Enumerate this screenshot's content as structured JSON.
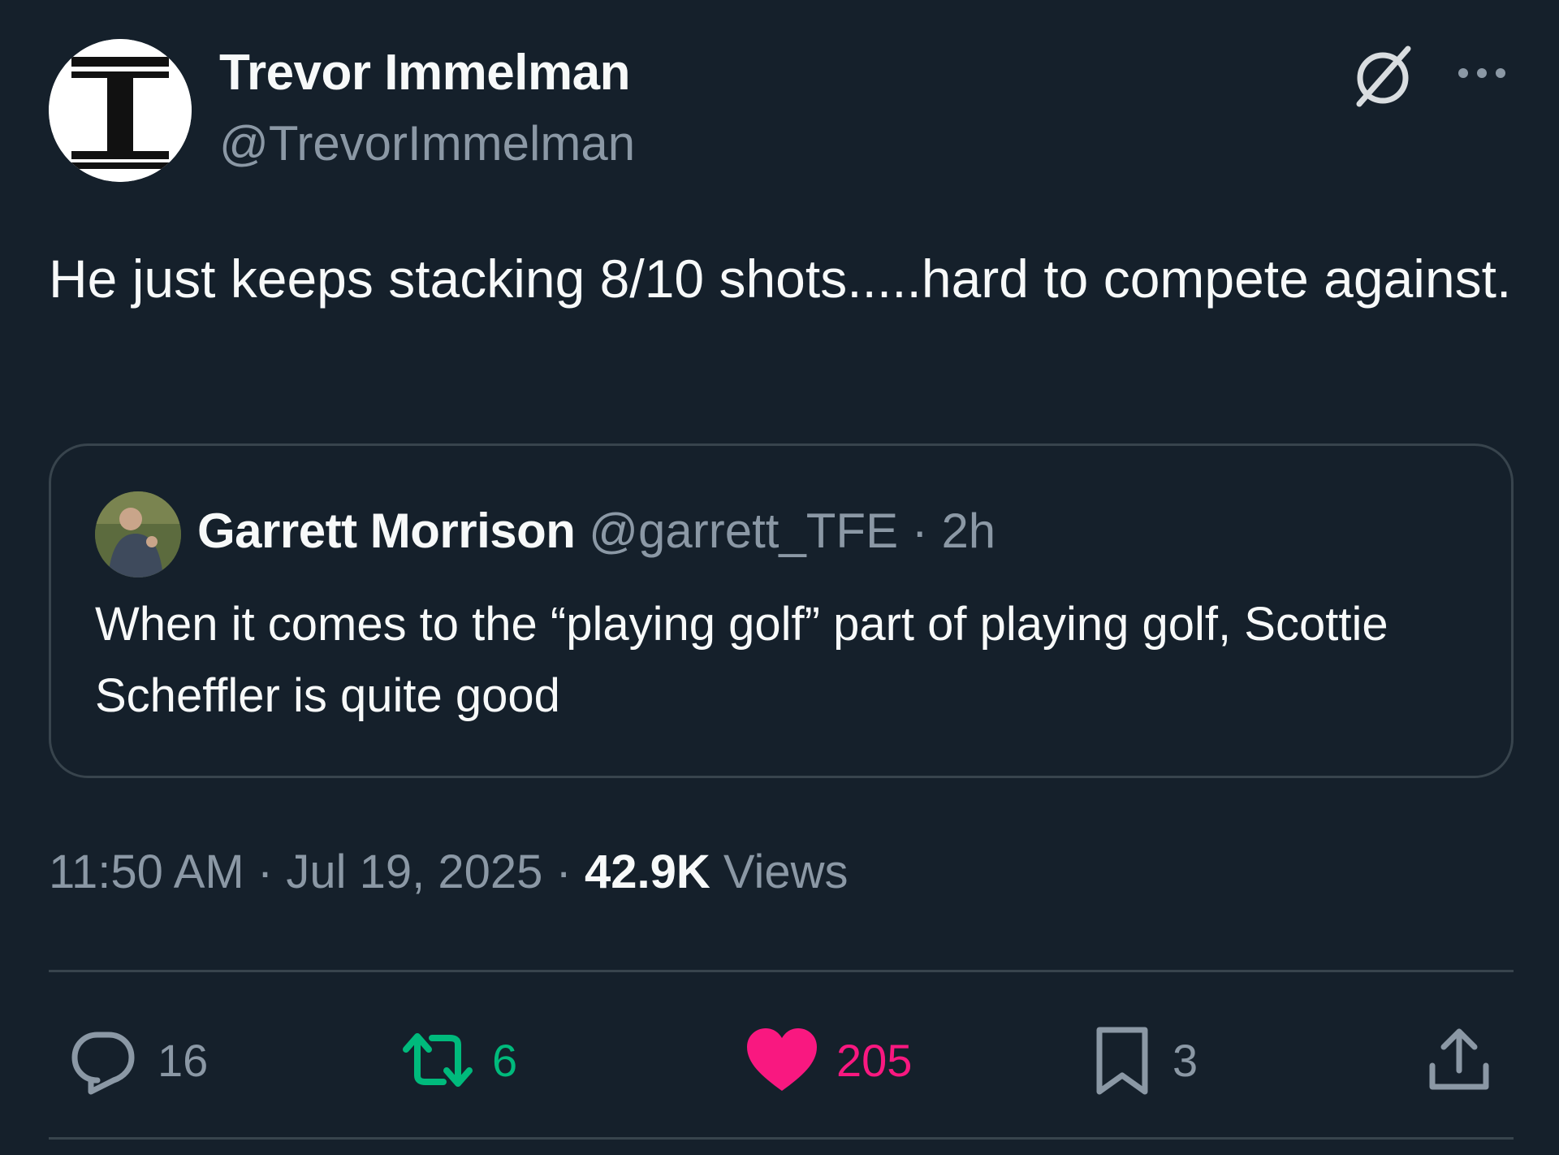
{
  "author": {
    "name": "Trevor Immelman",
    "handle": "@TrevorImmelman",
    "avatar_icon": "letter-t-logo"
  },
  "tweet": {
    "text": "He just keeps stacking 8/10 shots.....hard to compete against."
  },
  "quote": {
    "name": "Garrett Morrison",
    "handle": "@garrett_TFE",
    "separator": "·",
    "time": "2h",
    "text": "When it comes to the “playing golf” part of playing golf, Scottie Scheffler is quite good"
  },
  "meta": {
    "time": "11:50 AM",
    "separator1": "·",
    "date": "Jul 19, 2025",
    "separator2": "·",
    "views_count": "42.9K",
    "views_label": "Views"
  },
  "actions": {
    "replies": "16",
    "reposts": "6",
    "likes": "205",
    "bookmarks": "3"
  },
  "icons": {
    "header": [
      "grok-icon",
      "more-icon"
    ],
    "actions": [
      "reply-icon",
      "repost-icon",
      "like-icon",
      "bookmark-icon",
      "share-icon"
    ]
  },
  "colors": {
    "background": "#15202b",
    "text": "#f7f9f9",
    "secondary": "#8b98a5",
    "border": "#38444d",
    "repost": "#00ba7c",
    "like": "#f91880"
  }
}
